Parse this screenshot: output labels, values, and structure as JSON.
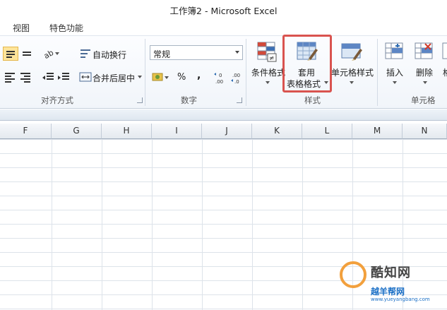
{
  "window": {
    "title": "工作簿2 - Microsoft Excel"
  },
  "tabs": [
    {
      "label": "视图"
    },
    {
      "label": "特色功能"
    }
  ],
  "ribbon": {
    "alignment": {
      "wrap_text": "自动换行",
      "merge_center": "合并后居中",
      "group_label": "对齐方式"
    },
    "number": {
      "format_value": "常规",
      "percent": "%",
      "comma": ",",
      "inc_decimal": ".00",
      "dec_decimal": ".0",
      "group_label": "数字"
    },
    "styles": {
      "conditional_formatting": "条件格式",
      "format_as_table_line1": "套用",
      "format_as_table_line2": "表格格式",
      "cell_styles": "单元格样式",
      "group_label": "样式"
    },
    "cells": {
      "insert": "插入",
      "delete": "删除",
      "format_partial": "格",
      "group_label": "单元格"
    }
  },
  "columns": [
    "F",
    "G",
    "H",
    "I",
    "J",
    "K",
    "L",
    "M",
    "N"
  ],
  "watermark": {
    "brand": "酷知网",
    "sub": "越羊帮网",
    "url": "www.yueyangbang.com"
  },
  "colors": {
    "highlight": "#d9534f",
    "accent_orange": "#f2a03d",
    "accent_blue": "#1a6fc6"
  }
}
